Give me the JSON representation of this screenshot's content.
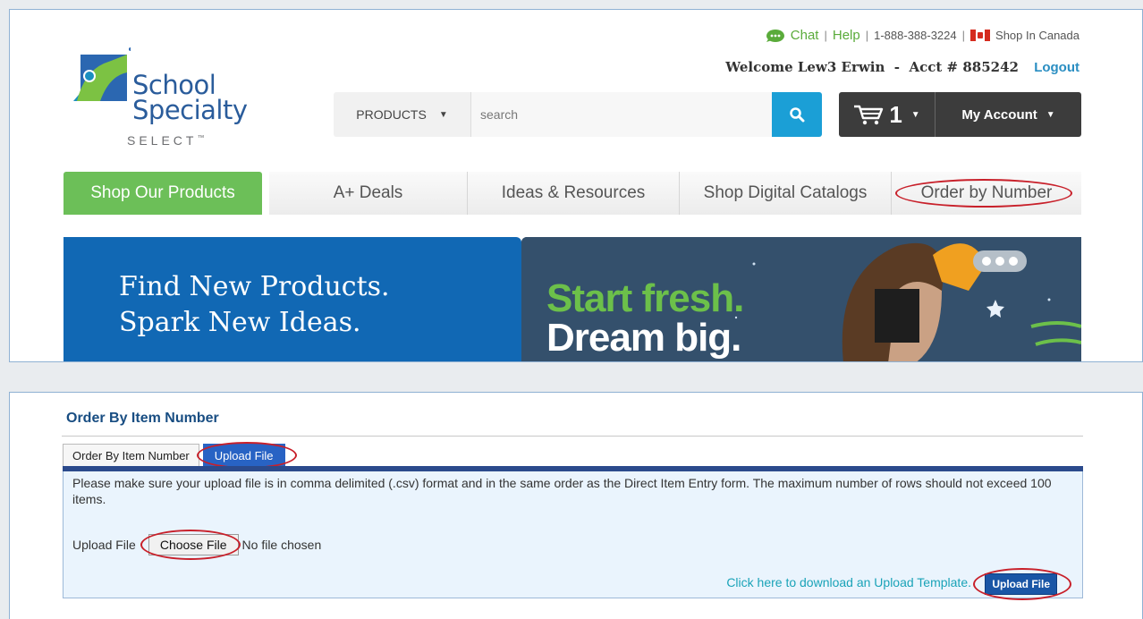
{
  "header": {
    "logo": {
      "line1": "School",
      "line2": "Specialty",
      "line3": "SELECT",
      "trademark": "™"
    },
    "utility": {
      "chat": "Chat",
      "help": "Help",
      "phone": "1-888-388-3224",
      "canada": "Shop In Canada",
      "separator": "|"
    },
    "welcome": {
      "text": "Welcome Lew3 Erwin  -  Acct # 885242",
      "logout": "Logout"
    },
    "search": {
      "category": "PRODUCTS",
      "placeholder": "search"
    },
    "cart": {
      "count": "1"
    },
    "account": {
      "label": "My Account"
    }
  },
  "nav": {
    "items": [
      {
        "label": "Shop Our Products"
      },
      {
        "label": "A+ Deals"
      },
      {
        "label": "Ideas & Resources"
      },
      {
        "label": "Shop Digital Catalogs"
      },
      {
        "label": "Order by Number"
      }
    ]
  },
  "hero": {
    "left_line1": "Find New Products.",
    "left_line2": "Spark New Ideas.",
    "right_line1": "Start fresh.",
    "right_line2": "Dream big."
  },
  "order": {
    "title": "Order By Item Number",
    "tabs": [
      {
        "label": "Order By Item Number"
      },
      {
        "label": "Upload File"
      }
    ],
    "notice": "Please make sure your upload file is in comma delimited (.csv) format and in the same order as the Direct Item Entry form. The maximum number of rows should not exceed 100 items.",
    "upload_label": "Upload File",
    "choose_file": "Choose File",
    "no_file": "No file chosen",
    "template_link": "Click here to download an Upload Template.",
    "upload_button": "Upload File"
  },
  "colors": {
    "brand_blue": "#2a5c9b",
    "green": "#6cbf58",
    "search_blue": "#1b9fd6",
    "annotation_red": "#c8202a"
  }
}
